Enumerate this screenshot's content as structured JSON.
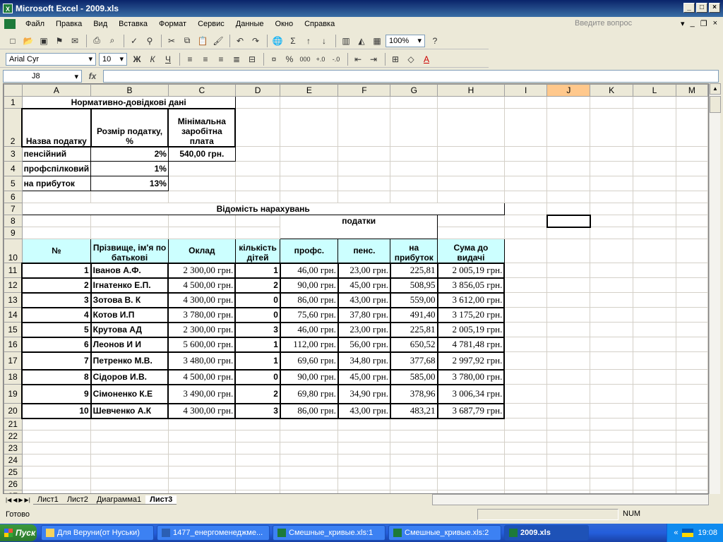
{
  "window": {
    "title": "Microsoft Excel - 2009.xls",
    "app_icon": "X"
  },
  "menu": {
    "items": [
      "Файл",
      "Правка",
      "Вид",
      "Вставка",
      "Формат",
      "Сервис",
      "Данные",
      "Окно",
      "Справка"
    ],
    "help_placeholder": "Введите вопрос"
  },
  "toolbar": {
    "zoom": "100%",
    "font_name": "Arial Cyr",
    "font_size": "10",
    "bold": "Ж",
    "italic": "К",
    "underline": "Ч",
    "percent": "%",
    "thousands": "000",
    "sum": "Σ"
  },
  "formula": {
    "name_box": "J8",
    "fx": "fx",
    "content": ""
  },
  "columns": [
    "A",
    "B",
    "C",
    "D",
    "E",
    "F",
    "G",
    "H",
    "I",
    "J",
    "K",
    "L",
    "M"
  ],
  "cells": {
    "title1": "Нормативно-довідкові дані",
    "a2": "Назва податку",
    "b2": "Розмір податку, %",
    "c2": "Мінімальна заробітна плата",
    "a3": "пенсійний",
    "b3": "2%",
    "c3": "540,00 грн.",
    "a4": "профспілковий",
    "b4": "1%",
    "a5": "на прибуток",
    "b5": "13%",
    "title2": "Відомість нарахувань",
    "taxes": "податки",
    "h_no": "№",
    "h_name": "Прізвище, ім'я по батькові",
    "h_salary": "Оклад",
    "h_kids": "кількість дітей",
    "h_prof": "профс.",
    "h_pens": "пенс.",
    "h_income": "на прибуток",
    "h_total": "Сума до видачі"
  },
  "rows": [
    {
      "no": "1",
      "name": "Іванов А.Ф.",
      "salary": "2 300,00 грн.",
      "kids": "1",
      "prof": "46,00 грн.",
      "pens": "23,00 грн.",
      "income": "225,81",
      "total": "2 005,19 грн."
    },
    {
      "no": "2",
      "name": "Ігнатенко Е.П.",
      "salary": "4 500,00 грн.",
      "kids": "2",
      "prof": "90,00 грн.",
      "pens": "45,00 грн.",
      "income": "508,95",
      "total": "3 856,05 грн."
    },
    {
      "no": "3",
      "name": "Зотова В. К",
      "salary": "4 300,00 грн.",
      "kids": "0",
      "prof": "86,00 грн.",
      "pens": "43,00 грн.",
      "income": "559,00",
      "total": "3 612,00 грн."
    },
    {
      "no": "4",
      "name": "Котов И.П",
      "salary": "3 780,00 грн.",
      "kids": "0",
      "prof": "75,60 грн.",
      "pens": "37,80 грн.",
      "income": "491,40",
      "total": "3 175,20 грн."
    },
    {
      "no": "5",
      "name": "Крутова АД",
      "salary": "2 300,00 грн.",
      "kids": "3",
      "prof": "46,00 грн.",
      "pens": "23,00 грн.",
      "income": "225,81",
      "total": "2 005,19 грн."
    },
    {
      "no": "6",
      "name": "Леонов И И",
      "salary": "5 600,00 грн.",
      "kids": "1",
      "prof": "112,00 грн.",
      "pens": "56,00 грн.",
      "income": "650,52",
      "total": "4 781,48 грн."
    },
    {
      "no": "7",
      "name": "Петренко М.В.",
      "salary": "3 480,00 грн.",
      "kids": "1",
      "prof": "69,60 грн.",
      "pens": "34,80 грн.",
      "income": "377,68",
      "total": "2 997,92 грн."
    },
    {
      "no": "8",
      "name": "Сідоров И.В.",
      "salary": "4 500,00 грн.",
      "kids": "0",
      "prof": "90,00 грн.",
      "pens": "45,00 грн.",
      "income": "585,00",
      "total": "3 780,00 грн."
    },
    {
      "no": "9",
      "name": "Сімоненко К.Е",
      "salary": "3 490,00 грн.",
      "kids": "2",
      "prof": "69,80 грн.",
      "pens": "34,90 грн.",
      "income": "378,96",
      "total": "3 006,34 грн."
    },
    {
      "no": "10",
      "name": "Шевченко А.К",
      "salary": "4 300,00 грн.",
      "kids": "3",
      "prof": "86,00 грн.",
      "pens": "43,00 грн.",
      "income": "483,21",
      "total": "3 687,79 грн."
    }
  ],
  "sheet_tabs": [
    "Лист1",
    "Лист2",
    "Диаграмма1",
    "Лист3"
  ],
  "active_tab": "Лист3",
  "status": {
    "ready": "Готово",
    "num": "NUM"
  },
  "taskbar": {
    "start": "Пуск",
    "tasks": [
      "Для Веруни(от Нуськи)",
      "1477_енергоменеджме...",
      "Смешные_кривые.xls:1",
      "Смешные_кривые.xls:2",
      "2009.xls"
    ],
    "clock": "19:08",
    "tray_arrow": "«"
  },
  "colors": {
    "header_fill": "#ccffff",
    "title_bar": "#0a246a",
    "taskbar": "#245edb",
    "start": "#3c9a3c"
  }
}
